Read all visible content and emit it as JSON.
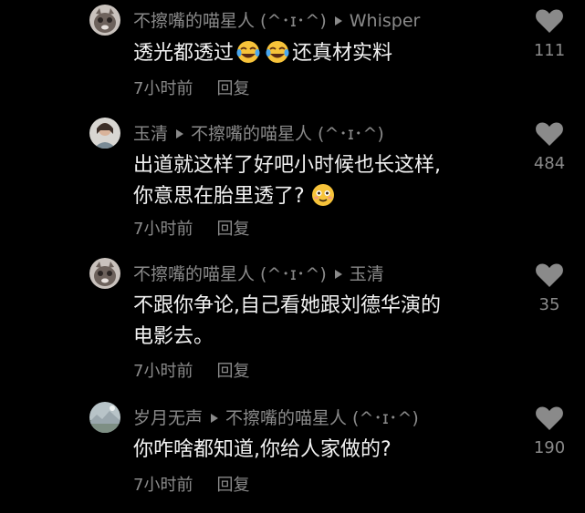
{
  "comments": [
    {
      "avatar": "cat-avatar",
      "author": "不擦嘴的喵星人 (^･ɪ･^)",
      "reply_to": "Whisper",
      "text_before": "透光都透过",
      "emojis": [
        "rolling-laughing-emoji",
        "rolling-laughing-emoji"
      ],
      "text_after": "还真材实料",
      "time": "7小时前",
      "reply_label": "回复",
      "likes": "111"
    },
    {
      "avatar": "person-avatar",
      "author": "玉清",
      "reply_to": "不擦嘴的喵星人 (^･ɪ･^)",
      "line1": "出道就这样了好吧小时候也长这样,",
      "line2": "你意思在胎里透了?",
      "emoji": "flushed-smile-emoji",
      "time": "7小时前",
      "reply_label": "回复",
      "likes": "484"
    },
    {
      "avatar": "cat-avatar",
      "author": "不擦嘴的喵星人 (^･ɪ･^)",
      "reply_to": "玉清",
      "line1": "不跟你争论,自己看她跟刘德华演的",
      "line2": "电影去。",
      "time": "7小时前",
      "reply_label": "回复",
      "likes": "35"
    },
    {
      "avatar": "landscape-avatar",
      "author": "岁月无声",
      "reply_to": "不擦嘴的喵星人 (^･ɪ･^)",
      "line1": "你咋啥都知道,你给人家做的?",
      "time": "7小时前",
      "reply_label": "回复",
      "likes": "190"
    }
  ],
  "colors": {
    "background": "#000000",
    "primary_text": "#f2f2f2",
    "secondary_text": "#8a8a8a",
    "heart": "#8a8a8a"
  },
  "icons": {
    "like": "heart-icon",
    "reply_arrow": "triangle-right-icon"
  }
}
